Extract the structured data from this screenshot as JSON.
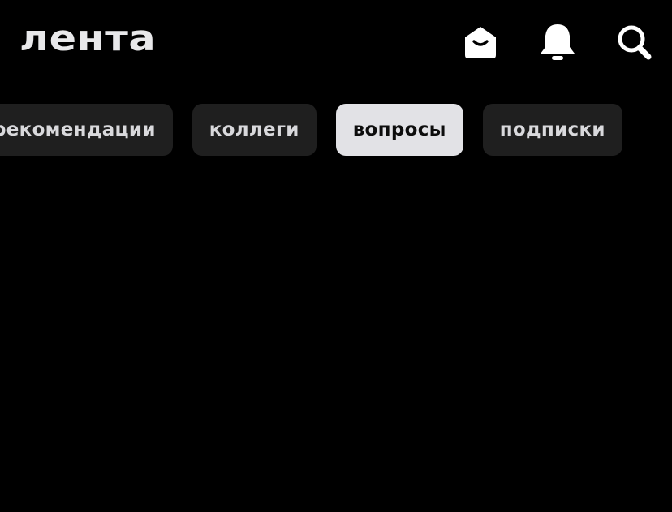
{
  "header": {
    "title": "лента",
    "icons": {
      "mail": "mail-icon",
      "notifications": "bell-icon",
      "search": "search-icon"
    }
  },
  "tabs": [
    {
      "label": "рекомендации",
      "active": false
    },
    {
      "label": "коллеги",
      "active": false
    },
    {
      "label": "вопросы",
      "active": true
    },
    {
      "label": "подписки",
      "active": false
    }
  ],
  "colors": {
    "background": "#000000",
    "tab_bg": "#1f1f1f",
    "tab_active_bg": "#e2e2e6",
    "tab_text": "#d9d9dc",
    "tab_active_text": "#0d0d0d"
  }
}
